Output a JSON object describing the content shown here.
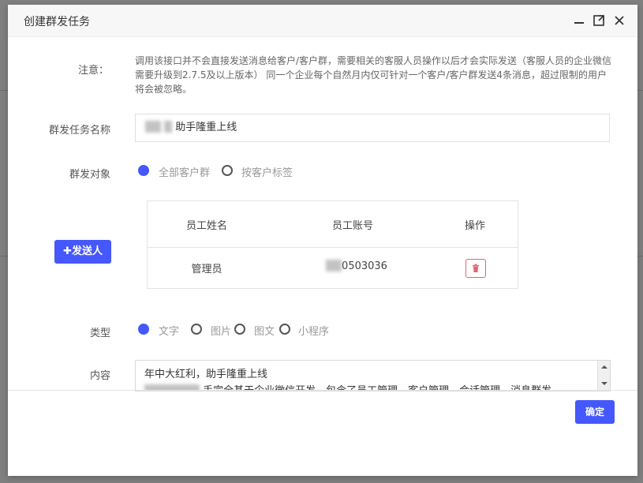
{
  "modal": {
    "title": "创建群发任务",
    "minimize_icon": "minimize-icon",
    "maximize_icon": "maximize-icon",
    "close_icon": "close-icon"
  },
  "notice": {
    "label": "注意：",
    "text": "调用该接口并不会直接发送消息给客户/客户群，需要相关的客服人员操作以后才会实际发送（客服人员的企业微信需要升级到2.7.5及以上版本） 同一个企业每个自然月内仅可针对一个客户/客户群发送4条消息，超过限制的用户将会被忽略。"
  },
  "task_name": {
    "label": "群发任务名称",
    "value_visible": "助手隆重上线"
  },
  "target": {
    "label": "群发对象",
    "options": [
      {
        "label": "全部客户群",
        "selected": true
      },
      {
        "label": "按客户标签",
        "selected": false
      }
    ]
  },
  "sender": {
    "button_label": "✚发送人",
    "table": {
      "headers": [
        "员工姓名",
        "员工账号",
        "操作"
      ],
      "rows": [
        {
          "name": "管理员",
          "account_visible": "0503036",
          "action_icon": "trash-icon"
        }
      ]
    }
  },
  "type": {
    "label": "类型",
    "options": [
      {
        "label": "文字",
        "selected": true
      },
      {
        "label": "图片",
        "selected": false
      },
      {
        "label": "图文",
        "selected": false
      },
      {
        "label": "小程序",
        "selected": false
      }
    ]
  },
  "content": {
    "label": "内容",
    "line1": "年中大红利，助手隆重上线",
    "line2": "手完全基于企业微信开发，包含了员工管理，客户管理，会话管理，消息群发，"
  },
  "footer": {
    "confirm_label": "确定"
  },
  "colors": {
    "accent": "#4458fb",
    "danger": "#e8616f"
  }
}
